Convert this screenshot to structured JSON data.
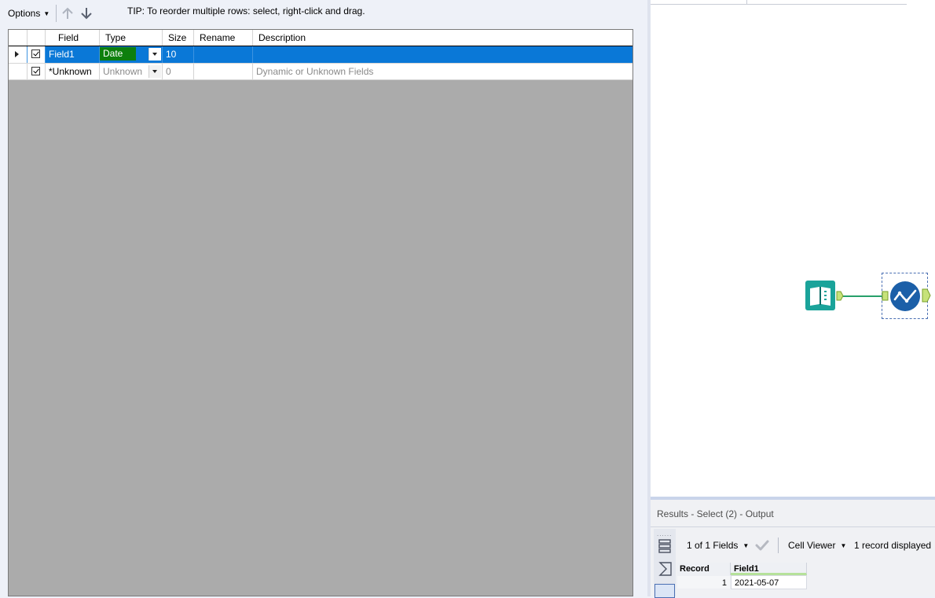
{
  "toolbar": {
    "options_label": "Options",
    "tip": "TIP: To reorder multiple rows: select, right-click and drag."
  },
  "grid": {
    "columns": [
      "Field",
      "Type",
      "Size",
      "Rename",
      "Description"
    ],
    "rows": [
      {
        "checked": true,
        "field": "Field1",
        "type": "Date",
        "size": "10",
        "rename": "",
        "description": "",
        "selected": true
      },
      {
        "checked": true,
        "field": "*Unknown",
        "type": "Unknown",
        "size": "0",
        "rename": "",
        "description": "Dynamic or Unknown Fields",
        "selected": false
      }
    ]
  },
  "results": {
    "title": "Results - Select (2) - Output",
    "fields_label": "1 of 1 Fields",
    "cell_viewer_label": "Cell Viewer",
    "record_count": "1 record displayed",
    "table": {
      "headers": [
        "Record",
        "Field1"
      ],
      "rows": [
        {
          "record": "1",
          "field1": "2021-05-07"
        }
      ]
    }
  },
  "colors": {
    "selection": "#0a78d7",
    "type_highlight": "#0d7f0d",
    "input_tool": "#1aa39a",
    "select_tool": "#1b5fa8",
    "connection": "#27a06a"
  },
  "icons": {
    "up": "arrow-up-icon",
    "down": "arrow-down-icon",
    "input": "input-data-book-icon",
    "select": "select-tool-check-icon"
  }
}
